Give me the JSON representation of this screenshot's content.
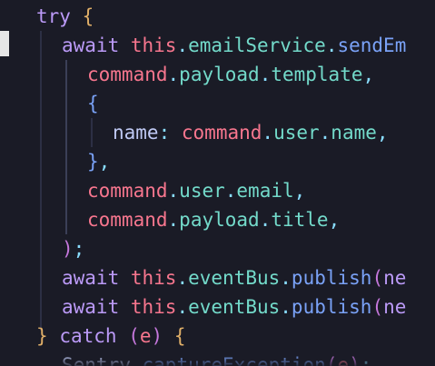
{
  "code": {
    "lines": [
      {
        "tokens": [
          {
            "t": "try",
            "c": "kw"
          },
          {
            "t": " ",
            "c": "plain"
          },
          {
            "t": "{",
            "c": "brace"
          }
        ]
      },
      {
        "tokens": [
          {
            "t": "await",
            "c": "kw"
          },
          {
            "t": " ",
            "c": "plain"
          },
          {
            "t": "this",
            "c": "obj"
          },
          {
            "t": ".",
            "c": "punct"
          },
          {
            "t": "emailService",
            "c": "prop"
          },
          {
            "t": ".",
            "c": "punct"
          },
          {
            "t": "sendEm",
            "c": "fn"
          }
        ]
      },
      {
        "tokens": [
          {
            "t": "command",
            "c": "obj"
          },
          {
            "t": ".",
            "c": "punct"
          },
          {
            "t": "payload",
            "c": "prop"
          },
          {
            "t": ".",
            "c": "punct"
          },
          {
            "t": "template",
            "c": "prop"
          },
          {
            "t": ",",
            "c": "punct"
          }
        ]
      },
      {
        "tokens": [
          {
            "t": "{",
            "c": "fn"
          }
        ]
      },
      {
        "tokens": [
          {
            "t": "name",
            "c": "plain"
          },
          {
            "t": ":",
            "c": "punct"
          },
          {
            "t": " ",
            "c": "plain"
          },
          {
            "t": "command",
            "c": "obj"
          },
          {
            "t": ".",
            "c": "punct"
          },
          {
            "t": "user",
            "c": "prop"
          },
          {
            "t": ".",
            "c": "punct"
          },
          {
            "t": "name",
            "c": "prop"
          },
          {
            "t": ",",
            "c": "punct"
          }
        ]
      },
      {
        "tokens": [
          {
            "t": "}",
            "c": "fn"
          },
          {
            "t": ",",
            "c": "punct"
          }
        ]
      },
      {
        "tokens": [
          {
            "t": "command",
            "c": "obj"
          },
          {
            "t": ".",
            "c": "punct"
          },
          {
            "t": "user",
            "c": "prop"
          },
          {
            "t": ".",
            "c": "punct"
          },
          {
            "t": "email",
            "c": "prop"
          },
          {
            "t": ",",
            "c": "punct"
          }
        ]
      },
      {
        "tokens": [
          {
            "t": "command",
            "c": "obj"
          },
          {
            "t": ".",
            "c": "punct"
          },
          {
            "t": "payload",
            "c": "prop"
          },
          {
            "t": ".",
            "c": "punct"
          },
          {
            "t": "title",
            "c": "prop"
          },
          {
            "t": ",",
            "c": "punct"
          }
        ]
      },
      {
        "tokens": [
          {
            "t": ")",
            "c": "paren"
          },
          {
            "t": ";",
            "c": "punct"
          }
        ]
      },
      {
        "tokens": [
          {
            "t": "await",
            "c": "kw"
          },
          {
            "t": " ",
            "c": "plain"
          },
          {
            "t": "this",
            "c": "obj"
          },
          {
            "t": ".",
            "c": "punct"
          },
          {
            "t": "eventBus",
            "c": "prop"
          },
          {
            "t": ".",
            "c": "punct"
          },
          {
            "t": "publish",
            "c": "fn"
          },
          {
            "t": "(",
            "c": "paren"
          },
          {
            "t": "ne",
            "c": "kw"
          }
        ]
      },
      {
        "tokens": [
          {
            "t": "await",
            "c": "kw"
          },
          {
            "t": " ",
            "c": "plain"
          },
          {
            "t": "this",
            "c": "obj"
          },
          {
            "t": ".",
            "c": "punct"
          },
          {
            "t": "eventBus",
            "c": "prop"
          },
          {
            "t": ".",
            "c": "punct"
          },
          {
            "t": "publish",
            "c": "fn"
          },
          {
            "t": "(",
            "c": "paren"
          },
          {
            "t": "ne",
            "c": "kw"
          }
        ]
      },
      {
        "tokens": [
          {
            "t": "}",
            "c": "brace"
          },
          {
            "t": " ",
            "c": "plain"
          },
          {
            "t": "catch",
            "c": "kw"
          },
          {
            "t": " ",
            "c": "plain"
          },
          {
            "t": "(",
            "c": "paren"
          },
          {
            "t": "e",
            "c": "obj"
          },
          {
            "t": ")",
            "c": "paren"
          },
          {
            "t": " ",
            "c": "plain"
          },
          {
            "t": "{",
            "c": "brace"
          }
        ]
      },
      {
        "tokens": [
          {
            "t": "Sentry",
            "c": "plain"
          },
          {
            "t": ".",
            "c": "punct"
          },
          {
            "t": "captureException",
            "c": "fn"
          },
          {
            "t": "(",
            "c": "paren"
          },
          {
            "t": "e",
            "c": "obj"
          },
          {
            "t": ")",
            "c": "paren"
          },
          {
            "t": ";",
            "c": "punct"
          }
        ]
      }
    ]
  },
  "colors": {
    "background": "#1a1b26",
    "keyword": "#bb9af7",
    "object": "#f7768e",
    "property": "#73daca",
    "function": "#7aa2f7",
    "brace": "#e0af68",
    "punctuation": "#89ddff"
  }
}
